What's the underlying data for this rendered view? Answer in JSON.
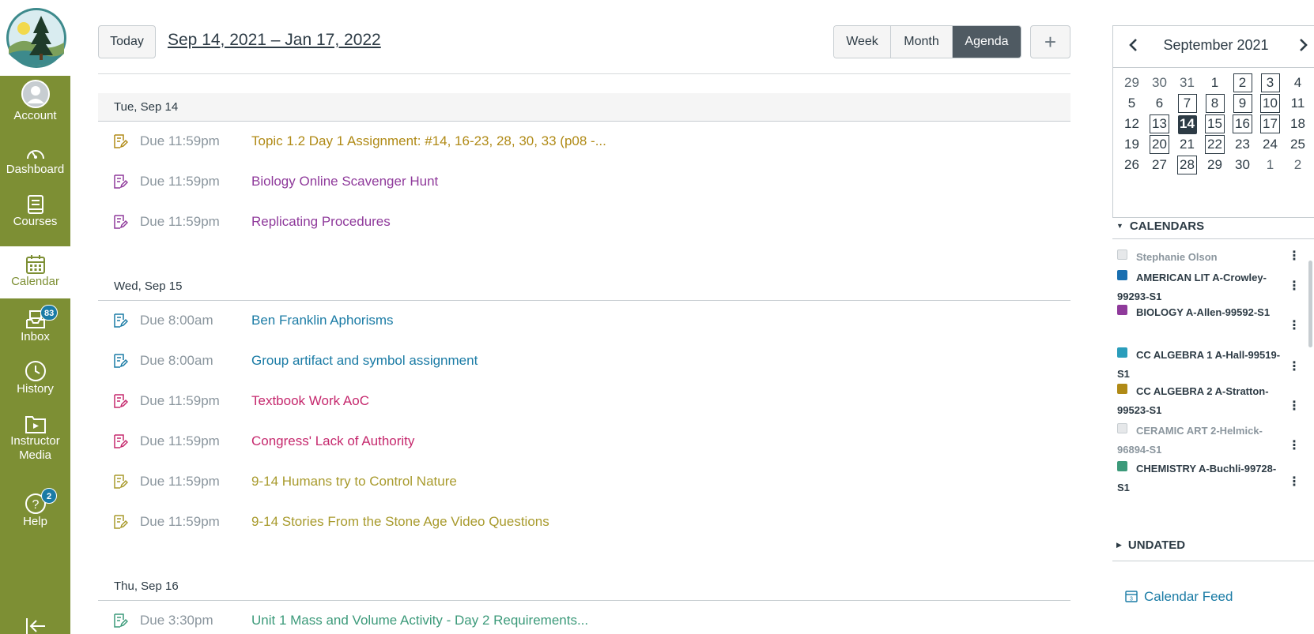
{
  "colors": {
    "nav_bg": "#7d8f34",
    "nav_active_text": "#7d8f34",
    "badge": "#1a7ba5",
    "link_blue": "#1a7ba5",
    "course_gold": "#b08a16",
    "course_purple": "#8f3a9b",
    "course_blue": "#1a7ba5",
    "course_red": "#c5286d",
    "course_olive": "#a89a2c",
    "course_green": "#3c9a7a"
  },
  "nav": {
    "account": "Account",
    "dashboard": "Dashboard",
    "courses": "Courses",
    "calendar": "Calendar",
    "inbox": "Inbox",
    "inbox_badge": "83",
    "history": "History",
    "instructor_media": "Instructor Media",
    "help": "Help",
    "help_badge": "2",
    "collapse_icon": "collapse-nav-icon"
  },
  "header": {
    "today_label": "Today",
    "date_range": "Sep 14, 2021 – Jan 17, 2022",
    "views": [
      "Week",
      "Month",
      "Agenda"
    ],
    "active_view": "Agenda",
    "add_label": "+"
  },
  "agenda": {
    "days": [
      {
        "label": "Tue, Sep 14",
        "events": [
          {
            "due": "Due 11:59pm",
            "title": "Topic 1.2 Day 1 Assignment: #14, 16-23, 28, 30, 33 (p08 -...",
            "color": "#b08a16"
          },
          {
            "due": "Due 11:59pm",
            "title": "Biology Online Scavenger Hunt",
            "color": "#8f3a9b"
          },
          {
            "due": "Due 11:59pm",
            "title": "Replicating Procedures",
            "color": "#8f3a9b"
          }
        ]
      },
      {
        "label": "Wed, Sep 15",
        "events": [
          {
            "due": "Due 8:00am",
            "title": "Ben Franklin Aphorisms",
            "color": "#1a7ba5"
          },
          {
            "due": "Due 8:00am",
            "title": "Group artifact and symbol assignment",
            "color": "#1a7ba5"
          },
          {
            "due": "Due 11:59pm",
            "title": "Textbook Work AoC",
            "color": "#c5286d"
          },
          {
            "due": "Due 11:59pm",
            "title": "Congress' Lack of Authority",
            "color": "#c5286d"
          },
          {
            "due": "Due 11:59pm",
            "title": "9-14 Humans try to Control Nature",
            "color": "#a89a2c"
          },
          {
            "due": "Due 11:59pm",
            "title": "9-14 Stories From the Stone Age Video Questions",
            "color": "#a89a2c"
          }
        ]
      },
      {
        "label": "Thu, Sep 16",
        "events": [
          {
            "due": "Due 3:30pm",
            "title": "Unit 1 Mass and Volume Activity - Day 2 Requirements...",
            "color": "#3c9a7a"
          }
        ]
      }
    ]
  },
  "minical": {
    "month": "September 2021",
    "weeks": [
      [
        "29",
        "30",
        "31",
        "1",
        "2",
        "3",
        "4"
      ],
      [
        "5",
        "6",
        "7",
        "8",
        "9",
        "10",
        "11"
      ],
      [
        "12",
        "13",
        "14",
        "15",
        "16",
        "17",
        "18"
      ],
      [
        "19",
        "20",
        "21",
        "22",
        "23",
        "24",
        "25"
      ],
      [
        "26",
        "27",
        "28",
        "29",
        "30",
        "1",
        "2"
      ]
    ],
    "other_month": [
      "0-0",
      "0-1",
      "0-2",
      "4-5",
      "4-6"
    ],
    "has_event": [
      "0-4",
      "0-5",
      "1-2",
      "1-3",
      "1-4",
      "1-5",
      "2-1",
      "2-3",
      "2-4",
      "2-5",
      "3-1",
      "3-3",
      "4-2"
    ],
    "today": "2-2"
  },
  "sidebar": {
    "calendars_label": "CALENDARS",
    "undated_label": "UNDATED",
    "calendar_feed": "Calendar Feed",
    "calendars": [
      {
        "name": "Stephanie Olson",
        "color": "#e6e8ea",
        "muted": true
      },
      {
        "name": "AMERICAN LIT A-Crowley-99293-S1",
        "color": "#1a6fb0",
        "muted": false
      },
      {
        "name": "BIOLOGY A-Allen-99592-S1",
        "color": "#8f3a9b",
        "muted": false
      },
      {
        "name": "CC ALGEBRA 1 A-Hall-99519-S1",
        "color": "#2a9dbb",
        "muted": false
      },
      {
        "name": "CC ALGEBRA 2 A-Stratton-99523-S1",
        "color": "#b08a16",
        "muted": false
      },
      {
        "name": "CERAMIC ART 2-Helmick-96894-S1",
        "color": "#e6e8ea",
        "muted": true
      },
      {
        "name": "CHEMISTRY A-Buchli-99728-S1",
        "color": "#3c9a7a",
        "muted": false
      }
    ]
  }
}
